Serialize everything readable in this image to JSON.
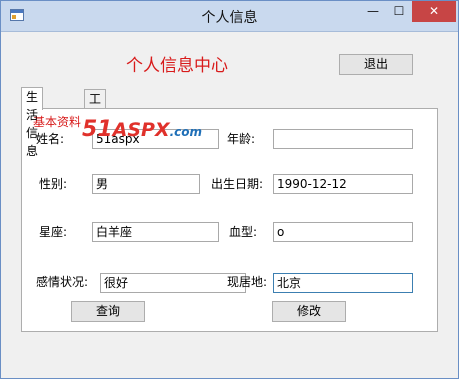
{
  "window": {
    "title": "个人信息",
    "min_symbol": "—",
    "max_symbol": "☐",
    "close_symbol": "✕"
  },
  "header": {
    "title": "个人信息中心",
    "exit_label": "退出"
  },
  "tabs": [
    {
      "label": "生活信息",
      "active": true
    },
    {
      "label": "工作信息",
      "active": false
    }
  ],
  "group": {
    "label": "基本资料"
  },
  "form": {
    "name": {
      "label": "姓名:",
      "value": "51aspx"
    },
    "age": {
      "label": "年龄:",
      "value": ""
    },
    "gender": {
      "label": "性别:",
      "value": "男"
    },
    "birthdate": {
      "label": "出生日期:",
      "value": "1990-12-12"
    },
    "zodiac": {
      "label": "星座:",
      "value": "白羊座"
    },
    "blood_type": {
      "label": "血型:",
      "value": "o"
    },
    "relationship": {
      "label": "感情状况:",
      "value": "很好"
    },
    "residence": {
      "label": "现居地:",
      "value": "北京"
    }
  },
  "buttons": {
    "query_label": "查询",
    "modify_label": "修改"
  },
  "watermark": {
    "part1": "51",
    "part2": "ASPX",
    "part3": ".com"
  },
  "colors": {
    "accent_red": "#d81b1b",
    "titlebar": "#c9d9ee",
    "close_button": "#c74545"
  }
}
